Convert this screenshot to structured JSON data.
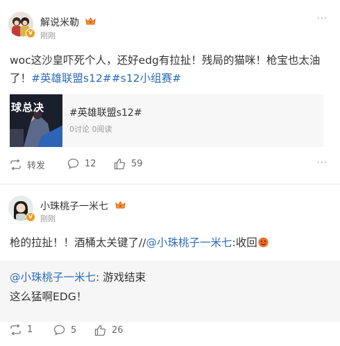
{
  "post1": {
    "author": "解说米勒",
    "time": "刚刚",
    "text_main": "woc这沙皇吓死个人，还好edg有拉扯！残局的猫咪！枪宝也太油了！",
    "tags": "#英雄联盟s12##s12小组赛#",
    "card": {
      "title": "#英雄联盟s12#",
      "stats": "0讨论 0阅读",
      "thumb_text": "球总决"
    },
    "actions": {
      "repost": "转发",
      "comments": "12",
      "likes": "59"
    },
    "more": "···"
  },
  "post2": {
    "author": "小珠桃子一米七",
    "time": "刚刚",
    "text_main": "枪的拉扯！！酒桶太关键了//",
    "mention": "@小珠桃子一米七",
    "text_tail": ":收回",
    "quote": {
      "mention": "@小珠桃子一米七",
      "line1_tail": ": 游戏结束",
      "line2": "这么猛啊EDG！"
    },
    "actions": {
      "reposts": "1",
      "comments": "5",
      "likes": "26"
    },
    "more": "···"
  },
  "colors": {
    "link": "#2c6bba",
    "badge": "#f09a1a",
    "muted": "#999999"
  },
  "icons": [
    "vip-crown-icon",
    "verified-v-icon",
    "repost-icon",
    "comment-icon",
    "like-icon",
    "more-icon",
    "emoji-icon"
  ]
}
